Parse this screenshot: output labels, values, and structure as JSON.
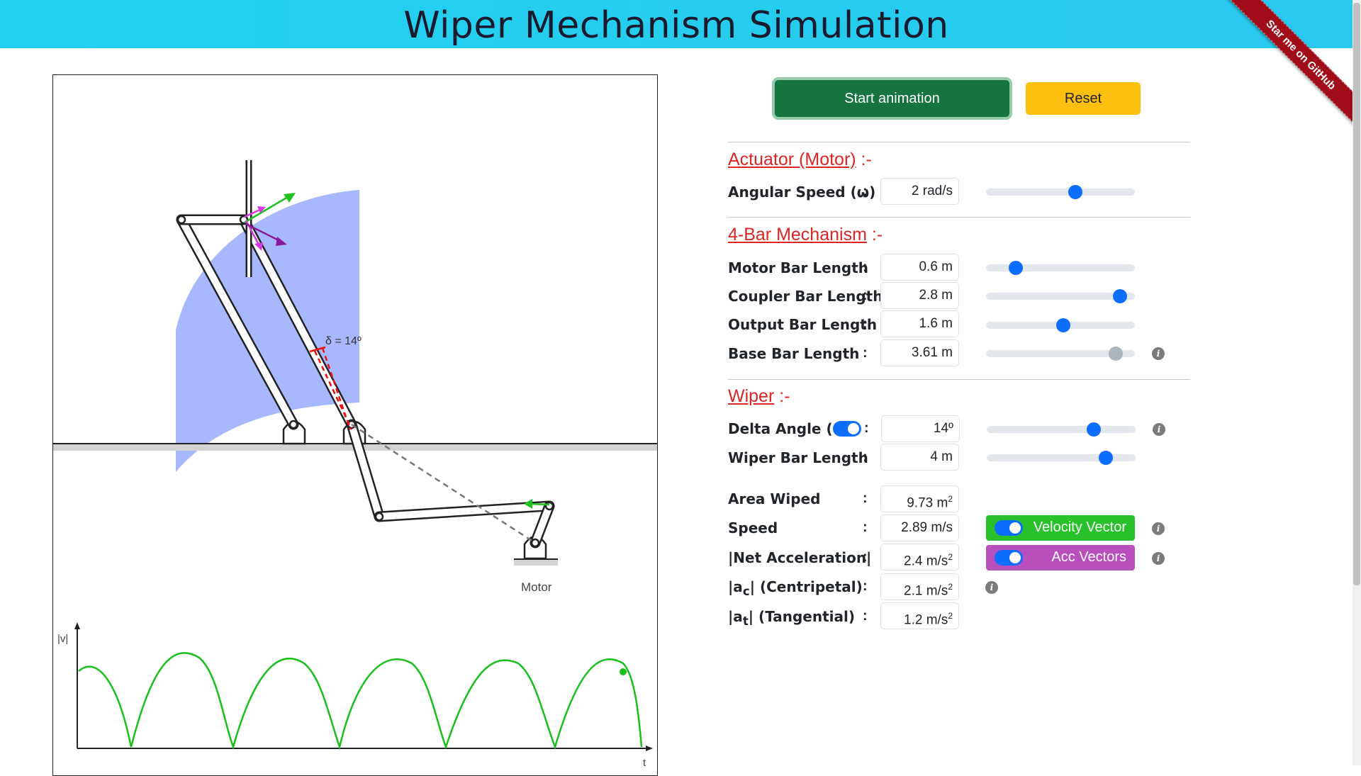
{
  "header": {
    "title": "Wiper Mechanism Simulation",
    "ribbon": "Star me on GitHub"
  },
  "buttons": {
    "start": "Start animation",
    "reset": "Reset"
  },
  "canvas": {
    "delta_annotation": "δ = 14º",
    "motor_label": "Motor",
    "graph_y_label": "|v|",
    "graph_x_label": "t"
  },
  "sections": {
    "actuator": {
      "title": "Actuator (Motor)",
      "suffix": " :-"
    },
    "mechanism": {
      "title": "4-Bar Mechanism",
      "suffix": " :-"
    },
    "wiper": {
      "title": "Wiper",
      "suffix": " :-"
    }
  },
  "fields": {
    "angular_speed": {
      "label": "Angular Speed (ω)",
      "value": "2 rad/s",
      "slider_fraction": 0.6
    },
    "motor_bar": {
      "label": "Motor Bar Length",
      "value": "0.6 m",
      "slider_fraction": 0.2
    },
    "coupler_bar": {
      "label": "Coupler Bar Length",
      "value": "2.8 m",
      "slider_fraction": 0.9
    },
    "output_bar": {
      "label": "Output Bar Length",
      "value": "1.6 m",
      "slider_fraction": 0.52
    },
    "base_bar": {
      "label": "Base Bar Length",
      "value": "3.61 m",
      "slider_fraction": 0.87
    },
    "delta_angle": {
      "label": "Delta Angle (δ)",
      "value": "14º",
      "slider_fraction": 0.72
    },
    "wiper_bar": {
      "label": "Wiper Bar Length",
      "value": "4 m",
      "slider_fraction": 0.8
    }
  },
  "outputs": {
    "area": {
      "label": "Area Wiped",
      "value": "9.73 m",
      "unit_sup": "2"
    },
    "speed": {
      "label": "Speed",
      "value": "2.89 m/s"
    },
    "net_acc": {
      "label": "|Net Acceleration|",
      "value": "2.4 m/s",
      "unit_sup": "2"
    },
    "centripetal": {
      "label_pre": "|a",
      "label_sub": "c",
      "label_post": "| (Centripetal)",
      "value": "2.1 m/s",
      "unit_sup": "2"
    },
    "tangential": {
      "label_pre": "|a",
      "label_sub": "t",
      "label_post": "| (Tangential)",
      "value": "1.2 m/s",
      "unit_sup": "2"
    }
  },
  "toggles": {
    "velocity": {
      "label": "Velocity Vector",
      "color": "#28c12c"
    },
    "acceleration": {
      "label": "Acc Vectors",
      "color": "#b94fbd"
    }
  },
  "colon": ":",
  "info_glyph": "i"
}
